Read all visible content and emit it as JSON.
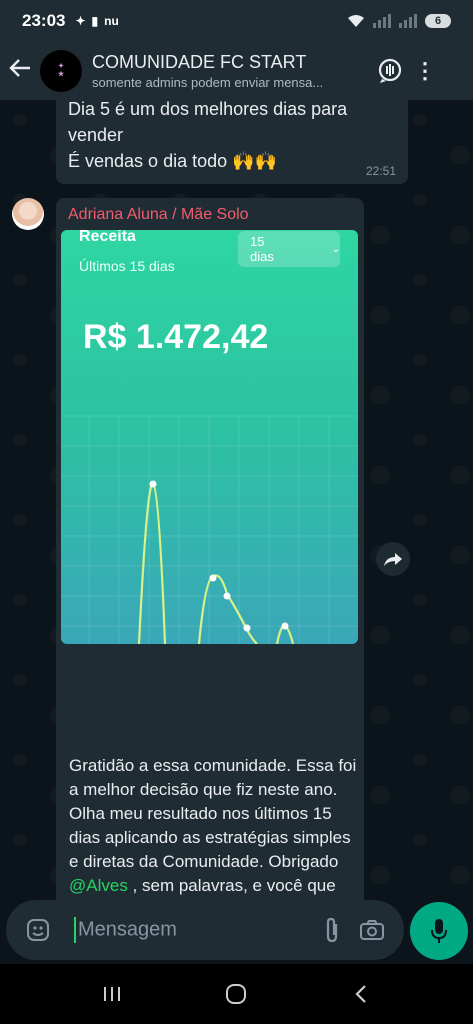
{
  "status_bar": {
    "time": "23:03",
    "left_indicators": "nu",
    "battery": "6"
  },
  "header": {
    "title": "COMUNIDADE FC START",
    "subtitle": "somente admins podem enviar mensa..."
  },
  "messages": [
    {
      "lines": [
        "Dia 5 é um dos melhores dias para",
        "vender",
        "É vendas o dia todo 🙌🙌"
      ],
      "time": "22:51"
    },
    {
      "sender": "Adriana Aluna / Mãe Solo",
      "card": {
        "title": "Receita",
        "subtitle": "Últimos 15 dias",
        "period_select": "15 dias",
        "amount": "R$ 1.472,42"
      },
      "text_before_mention": "Gratidão a essa comunidade. Essa foi a melhor decisão que fiz neste ano. Olha meu resultado nos últimos 15 dias aplicando as estratégias simples e diretas da Comunidade. Obrigado ",
      "mention": "@Alves",
      "text_after_mention": " , sem palavras, e você que ainda está na dúvida, tome a decisão porque vale muito a pena."
    }
  ],
  "input": {
    "placeholder": "Mensagem"
  },
  "colors": {
    "accent": "#00a884",
    "sender_name": "#f15c6d",
    "mention": "#25d366",
    "chart_line": "#d8f28a"
  }
}
